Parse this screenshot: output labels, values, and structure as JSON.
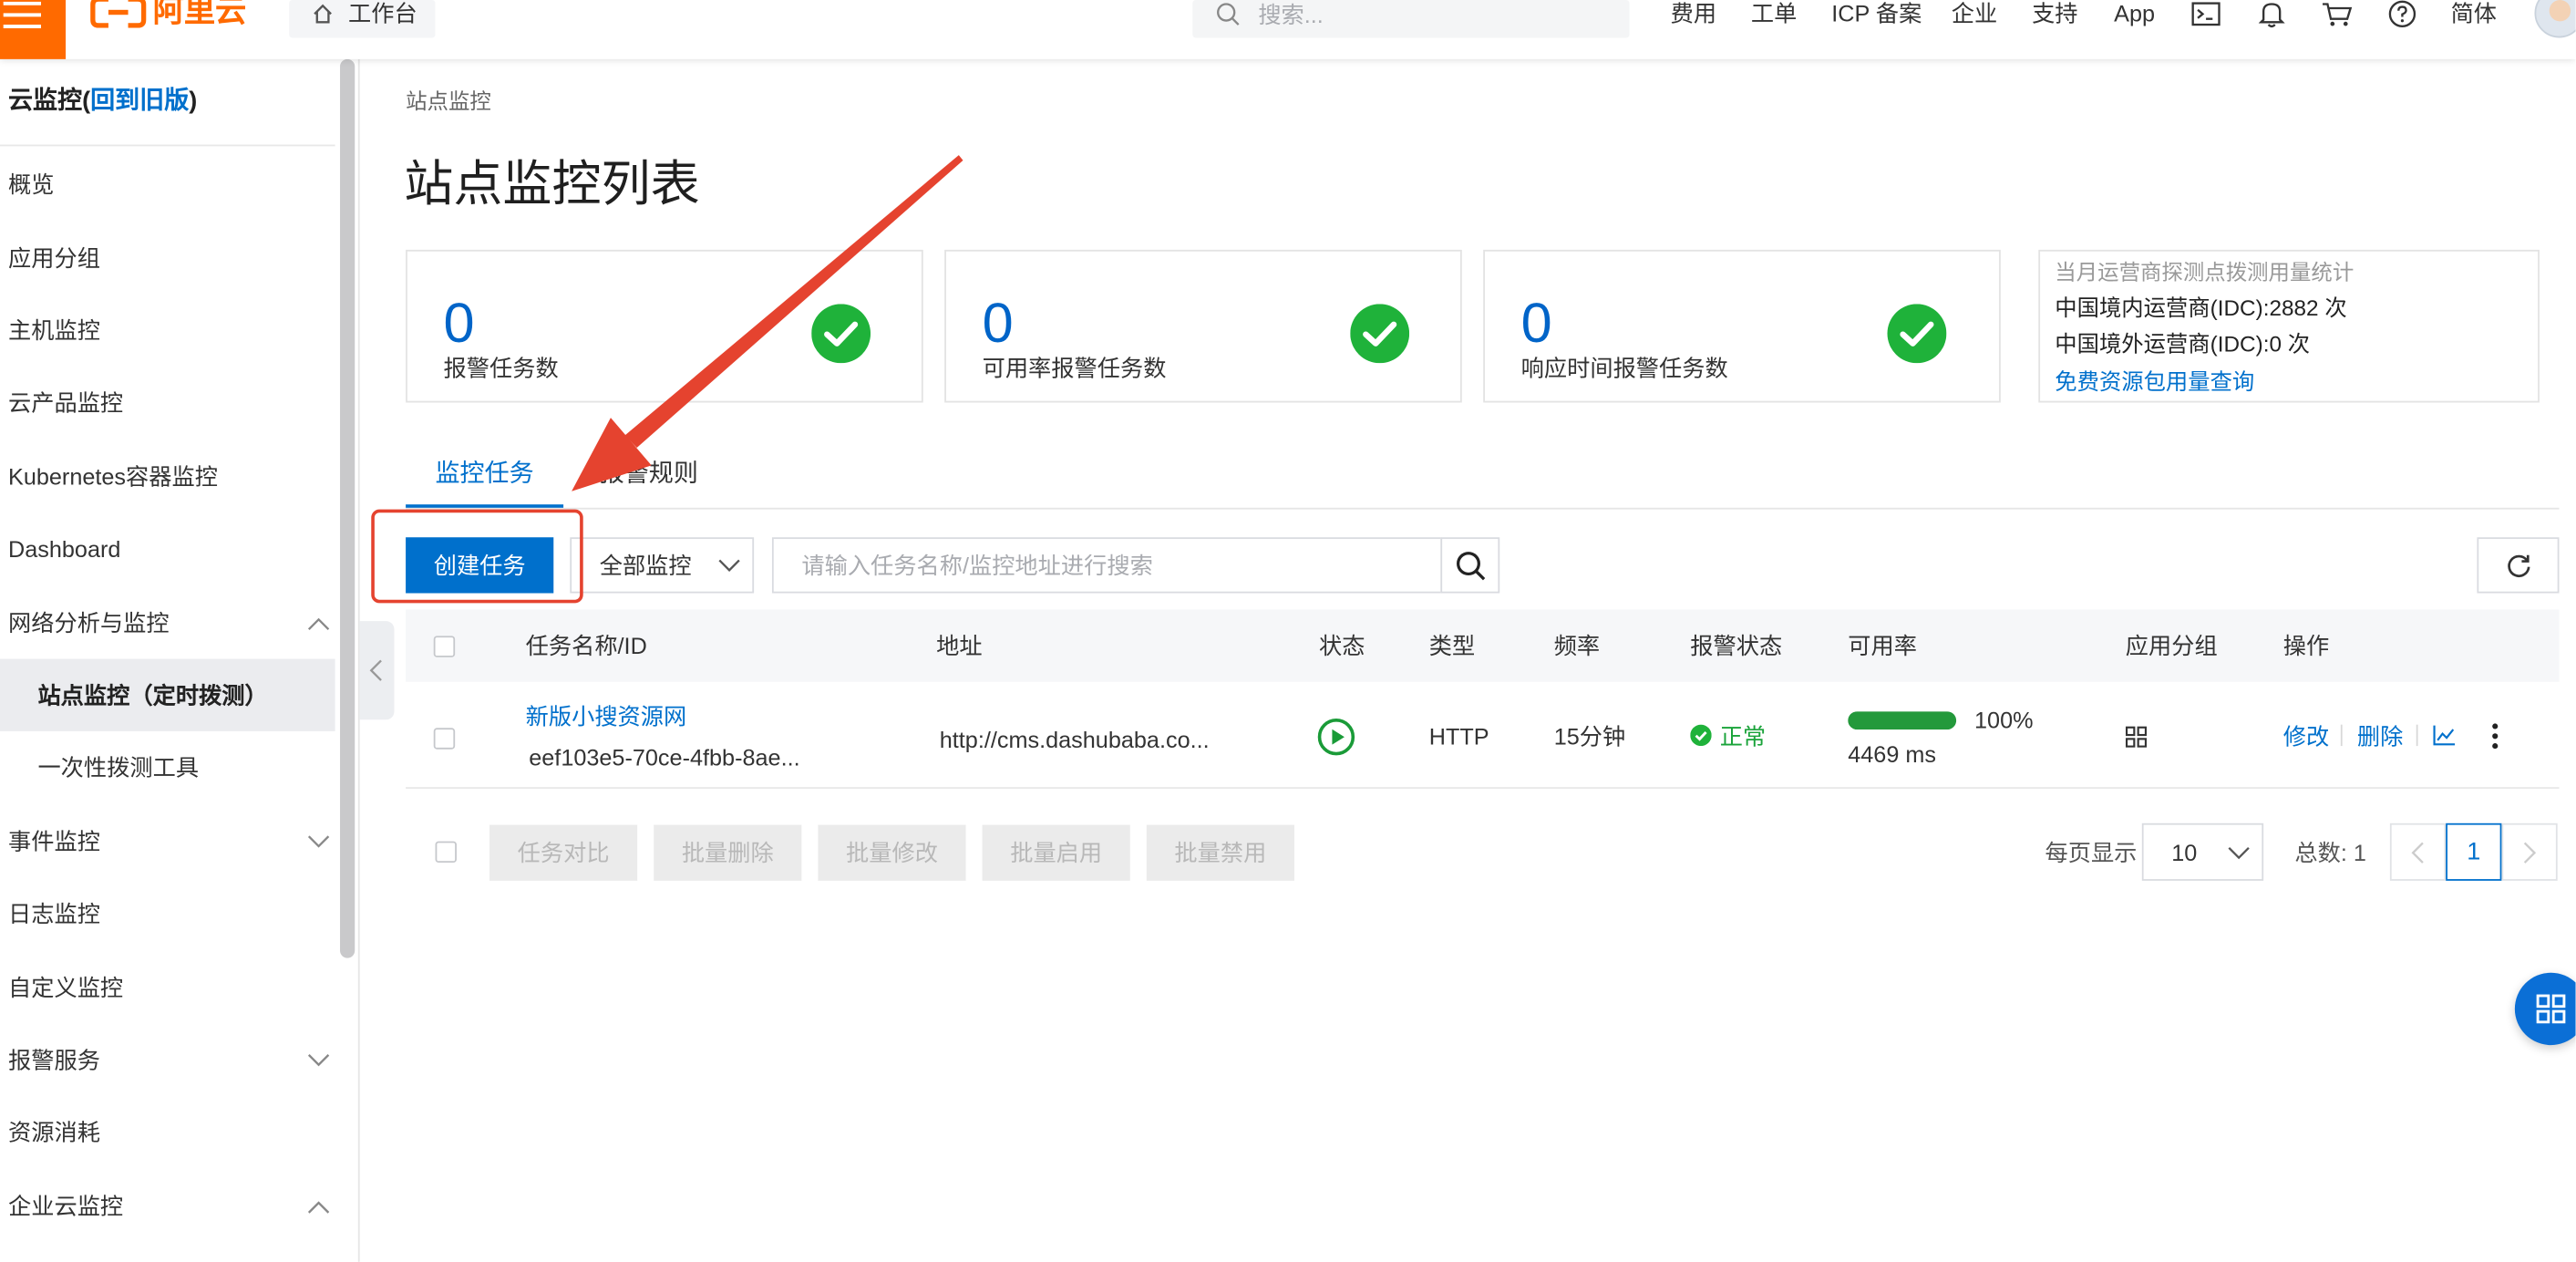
{
  "topbar": {
    "menu_icon": "hamburger-icon",
    "logo_text": "阿里云",
    "workbench_label": "工作台",
    "search_placeholder": "搜索...",
    "nav": [
      "费用",
      "工单",
      "ICP 备案",
      "企业",
      "支持",
      "App"
    ],
    "icons": [
      "terminal-icon",
      "bell-icon",
      "cart-icon",
      "help-icon"
    ],
    "lang_label": "简体"
  },
  "sidebar": {
    "title_prefix": "云监控(",
    "title_link": "回到旧版",
    "title_suffix": ")",
    "items": [
      {
        "label": "概览"
      },
      {
        "label": "应用分组"
      },
      {
        "label": "主机监控"
      },
      {
        "label": "云产品监控"
      },
      {
        "label": "Kubernetes容器监控"
      },
      {
        "label": "Dashboard"
      },
      {
        "label": "网络分析与监控",
        "icon": "chevron-up-icon",
        "expanded": true
      },
      {
        "label": "站点监控（定时拨测）",
        "active": true
      },
      {
        "label": "一次性拨测工具"
      },
      {
        "label": "事件监控",
        "icon": "chevron-down-icon",
        "expanded": false
      },
      {
        "label": "日志监控"
      },
      {
        "label": "自定义监控"
      },
      {
        "label": "报警服务",
        "icon": "chevron-down-icon",
        "expanded": false
      },
      {
        "label": "资源消耗"
      },
      {
        "label": "企业云监控",
        "icon": "chevron-up-icon",
        "expanded": true
      }
    ]
  },
  "main": {
    "breadcrumb": "站点监控",
    "title": "站点监控列表",
    "stats": [
      {
        "value": "0",
        "label": "报警任务数"
      },
      {
        "value": "0",
        "label": "可用率报警任务数"
      },
      {
        "value": "0",
        "label": "响应时间报警任务数"
      }
    ],
    "usage": {
      "title": "当月运营商探测点拨测用量统计",
      "domestic": "中国境内运营商(IDC):2882 次",
      "overseas": "中国境外运营商(IDC):0 次",
      "link": "免费资源包用量查询"
    },
    "tabs": [
      {
        "label": "监控任务",
        "active": true
      },
      {
        "label": "报警规则",
        "active": false
      }
    ],
    "toolbar": {
      "create_button": "创建任务",
      "filter_select": "全部监控",
      "search_placeholder": "请输入任务名称/监控地址进行搜索"
    },
    "table": {
      "columns": [
        "任务名称/ID",
        "地址",
        "状态",
        "类型",
        "频率",
        "报警状态",
        "可用率",
        "应用分组",
        "操作"
      ],
      "rows": [
        {
          "name": "新版小搜资源网",
          "id": "eef103e5-70ce-4fbb-8ae...",
          "address": "http://cms.dashubaba.co...",
          "status_icon": "play-circle-icon",
          "type": "HTTP",
          "frequency": "15分钟",
          "alert_status": "正常",
          "availability_pct": 100,
          "availability_label": "100%",
          "response_time": "4469 ms",
          "actions": [
            "修改",
            "删除"
          ]
        }
      ]
    },
    "batch_buttons": [
      "任务对比",
      "批量删除",
      "批量修改",
      "批量启用",
      "批量禁用"
    ],
    "pagination": {
      "page_size_label": "每页显示",
      "page_size": "10",
      "total_label": "总数: 1",
      "current_page": "1"
    }
  },
  "colors": {
    "brand": "#ff6a00",
    "primary": "#0070cc",
    "success": "#1fb23a",
    "annotation": "#e5432f"
  }
}
